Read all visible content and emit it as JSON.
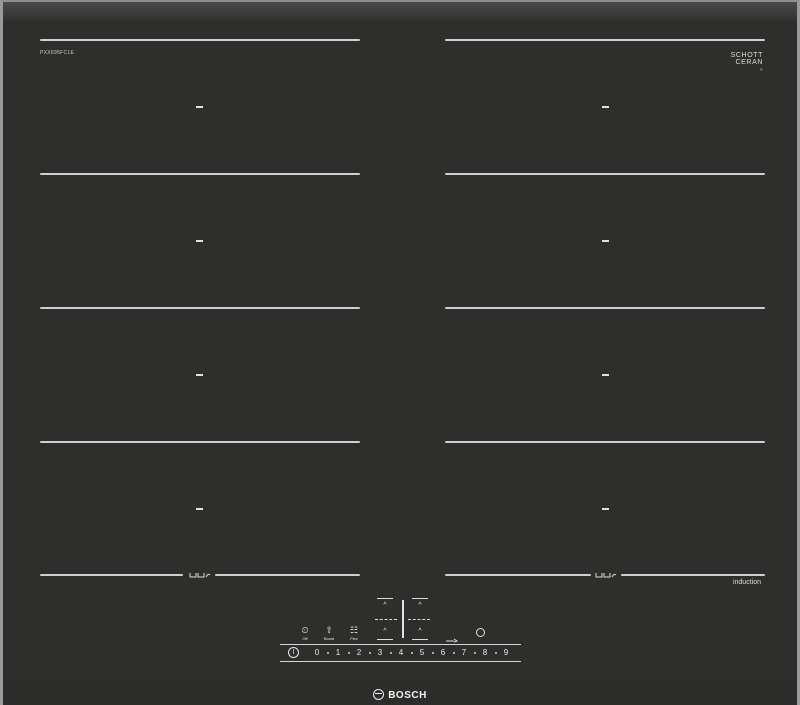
{
  "model_code": "PXX695FC1E",
  "brand_glass": {
    "line1": "SCHOTT",
    "line2": "CERAN",
    "line3": "®"
  },
  "zones": [
    {
      "row": 1,
      "side": "left"
    },
    {
      "row": 1,
      "side": "right"
    },
    {
      "row": 2,
      "side": "left"
    },
    {
      "row": 2,
      "side": "right"
    },
    {
      "row": 3,
      "side": "left"
    },
    {
      "row": 3,
      "side": "right"
    },
    {
      "row": 4,
      "side": "left"
    },
    {
      "row": 4,
      "side": "right"
    }
  ],
  "induction_label": "induction",
  "controls": {
    "functions": [
      {
        "name": "Off",
        "icon": "⏲"
      },
      {
        "name": "Boost",
        "icon": "⇧"
      },
      {
        "name": "Flex",
        "icon": "☷"
      }
    ],
    "power_symbol": "I",
    "levels": [
      "0",
      "1",
      "2",
      "3",
      "4",
      "5",
      "6",
      "7",
      "8",
      "9"
    ]
  },
  "brand": "BOSCH"
}
